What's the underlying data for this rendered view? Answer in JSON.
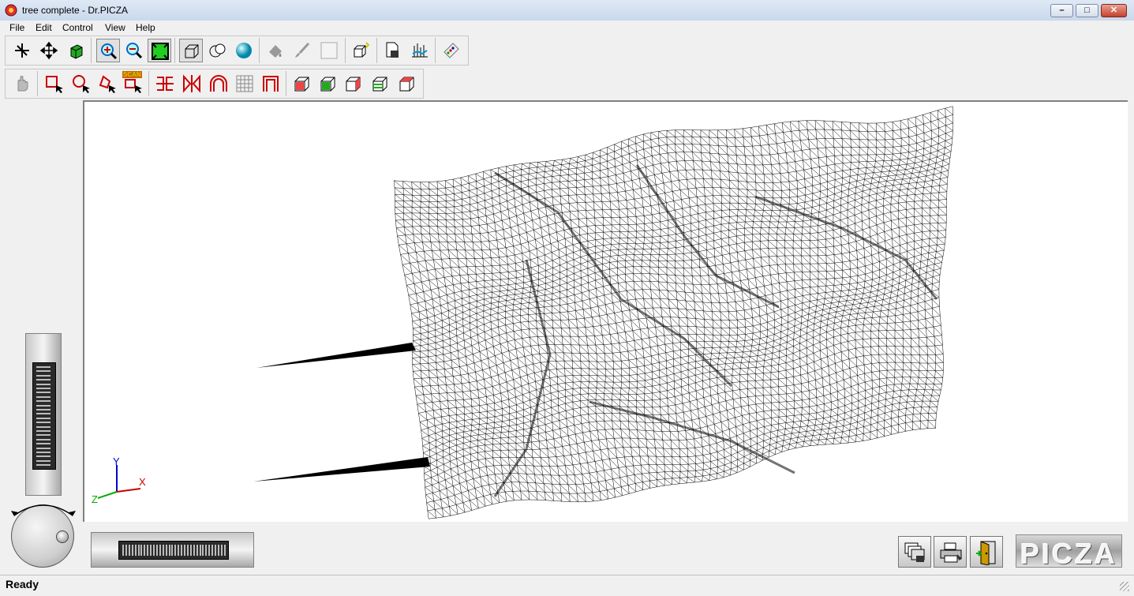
{
  "window": {
    "title": "tree complete - Dr.PICZA"
  },
  "menu": {
    "items": [
      "File",
      "Edit",
      "Control",
      "View",
      "Help"
    ]
  },
  "toolbar1": {
    "buttons": [
      "rotate-icon",
      "move-icon",
      "cube-move-icon",
      "zoom-in-icon",
      "zoom-out-icon",
      "zoom-fit-icon",
      "wireframe-icon",
      "hidden-line-icon",
      "shaded-icon",
      "paint-icon",
      "brush-icon",
      "blank-icon",
      "cube-stack-icon",
      "document-icon",
      "scan-icon",
      "settings-icon"
    ]
  },
  "toolbar2": {
    "buttons": [
      "hand-icon",
      "rect-select-icon",
      "circle-select-icon",
      "lasso-select-icon",
      "scan-select-icon",
      "trim-icon",
      "mirror-icon",
      "arch-icon",
      "grid-icon",
      "frame-icon",
      "box-front-icon",
      "box-green-icon",
      "box-side-icon",
      "box-layers-icon",
      "box-red-icon"
    ],
    "scan_badge": "SCAN"
  },
  "axis": {
    "x": "X",
    "y": "Y",
    "z": "Z"
  },
  "logo": "PICZA",
  "status": {
    "text": "Ready"
  }
}
